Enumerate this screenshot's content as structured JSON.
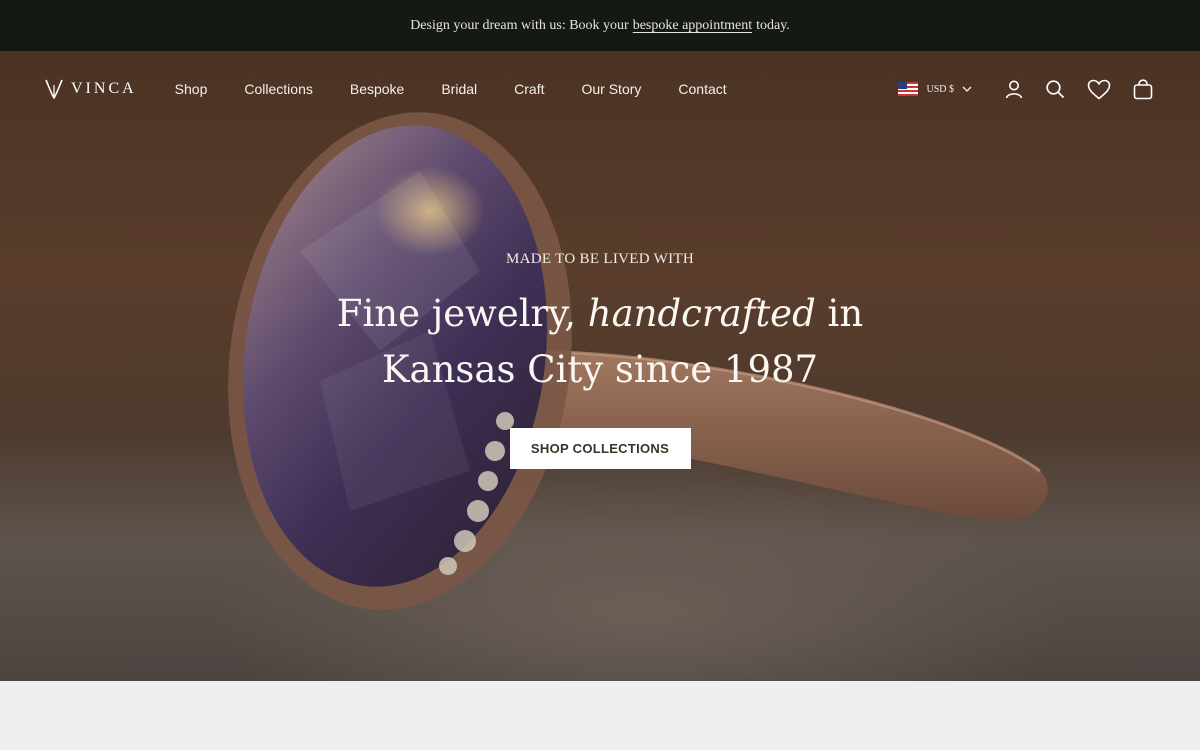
{
  "announcement": {
    "before": "Design your dream with us: Book your",
    "link": "bespoke appointment",
    "after": "today."
  },
  "header": {
    "brand": "VINCA",
    "nav": [
      "Shop",
      "Collections",
      "Bespoke",
      "Bridal",
      "Craft",
      "Our Story",
      "Contact"
    ],
    "currency": "USD $",
    "icons": [
      "flag-us-icon",
      "chevron-down-icon",
      "account-icon",
      "search-icon",
      "heart-icon",
      "bag-icon"
    ]
  },
  "hero": {
    "eyebrow": "MADE TO BE LIVED WITH",
    "headline_1": "Fine jewelry,",
    "headline_italic": "handcrafted",
    "headline_2": "in",
    "headline_3": "Kansas City since 1987",
    "cta": "SHOP COLLECTIONS"
  },
  "colors": {
    "announcement_bg": "#141a13",
    "hero_overlay": "#4b3224",
    "cta_bg": "#ffffff",
    "cta_text": "#3b3327",
    "page_bg": "#efefef"
  }
}
